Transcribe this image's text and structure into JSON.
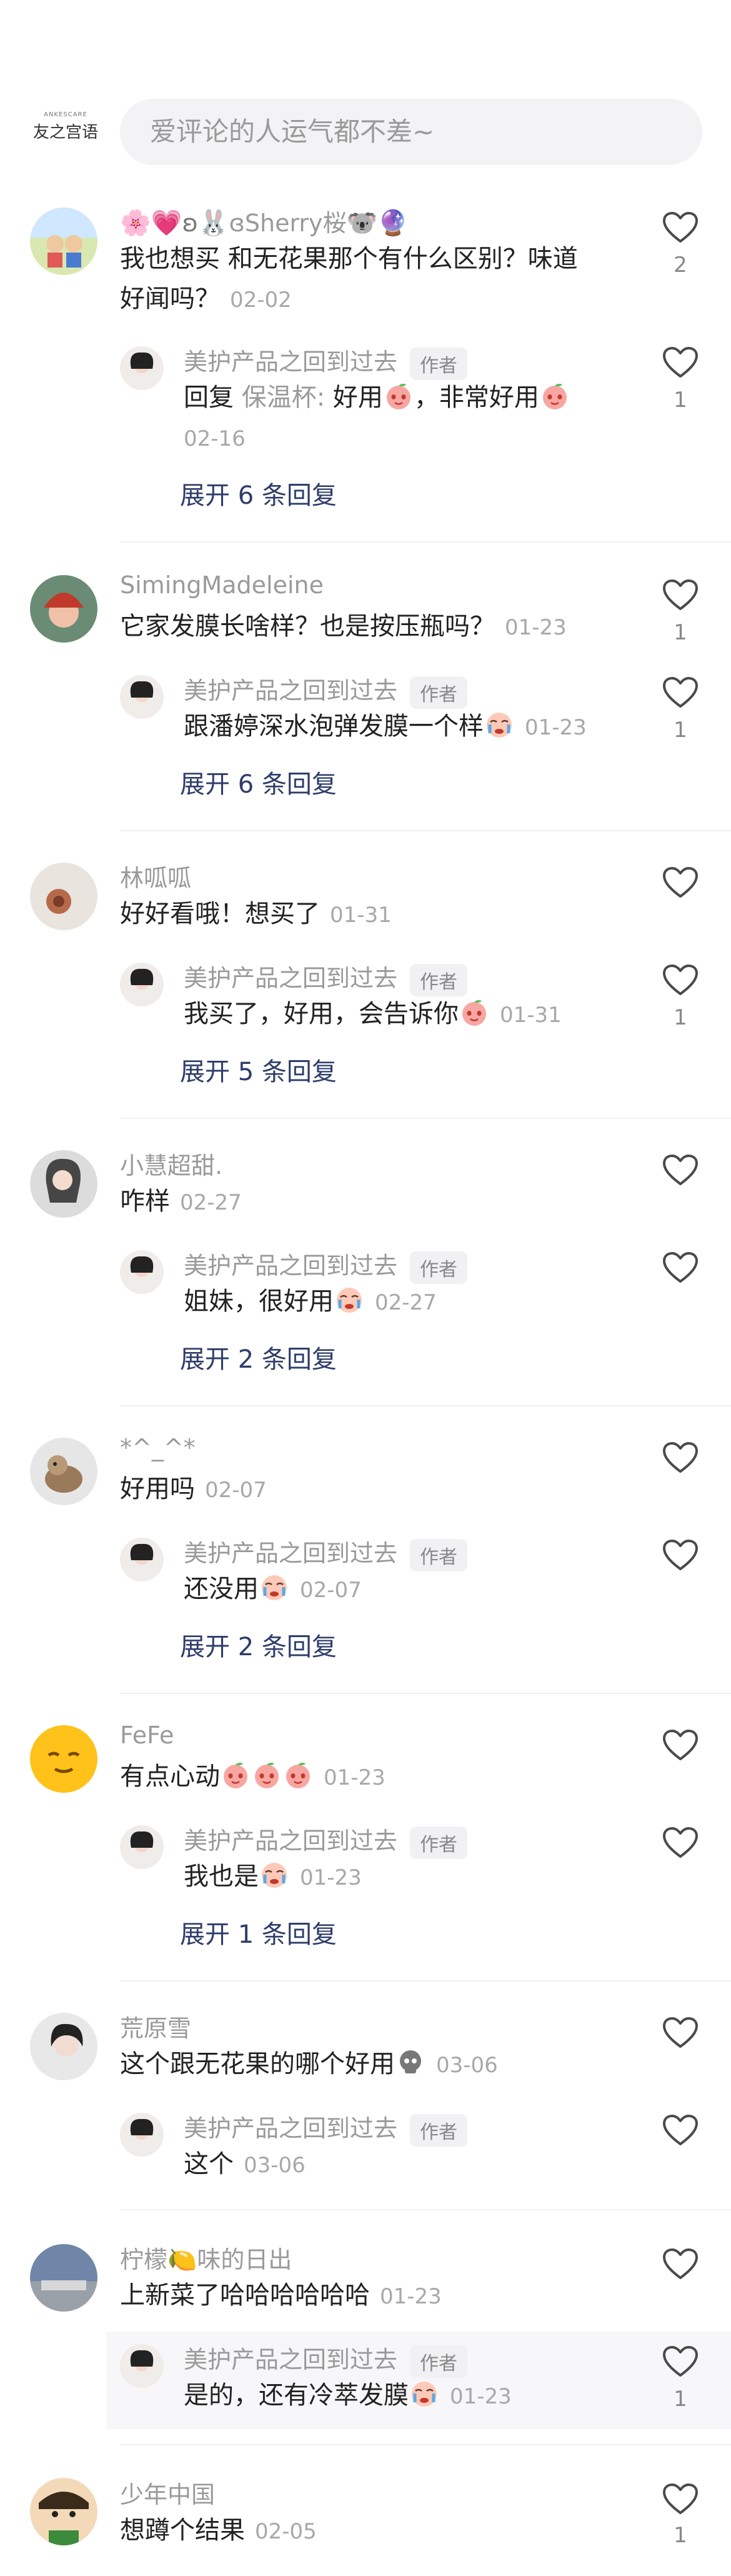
{
  "header": {
    "brand_small": "ANKESCARE",
    "brand_big": "友之宫语",
    "search_placeholder": "爱评论的人运气都不差~"
  },
  "labels": {
    "author": "作者",
    "reply_prefix": "回复"
  },
  "comments": [
    {
      "name": "ɞSherry桜",
      "text_line1": "我也想买  和无花果那个有什么区别？味道",
      "text_line2": "好闻吗？",
      "time": "02-02",
      "likes": "2",
      "reply": {
        "name": "美护产品之回到过去",
        "mention": "保温杯:",
        "text": "好用",
        "text2": "，非常好用",
        "time": "02-16",
        "likes": "1"
      },
      "expand": "展开 6 条回复"
    },
    {
      "name": "SimingMadeleine",
      "text": "它家发膜长啥样？也是按压瓶吗？",
      "time": "01-23",
      "likes": "1",
      "reply": {
        "name": "美护产品之回到过去",
        "text": "跟潘婷深水泡弹发膜一个样",
        "time": "01-23",
        "likes": "1"
      },
      "expand": "展开 6 条回复"
    },
    {
      "name": "林呱呱",
      "text": "好好看哦！想买了",
      "time": "01-31",
      "likes": "",
      "reply": {
        "name": "美护产品之回到过去",
        "text": "我买了，好用，会告诉你",
        "time": "01-31",
        "likes": "1"
      },
      "expand": "展开 5 条回复"
    },
    {
      "name": "小慧超甜.",
      "text": "咋样",
      "time": "02-27",
      "likes": "",
      "reply": {
        "name": "美护产品之回到过去",
        "text": "姐妹，很好用",
        "time": "02-27",
        "likes": ""
      },
      "expand": "展开 2 条回复"
    },
    {
      "name": "*^_^*",
      "text": "好用吗",
      "time": "02-07",
      "likes": "",
      "reply": {
        "name": "美护产品之回到过去",
        "text": "还没用",
        "time": "02-07",
        "likes": ""
      },
      "expand": "展开 2 条回复"
    },
    {
      "name": "FeFe",
      "text": "有点心动",
      "time": "01-23",
      "likes": "",
      "reply": {
        "name": "美护产品之回到过去",
        "text": "我也是",
        "time": "01-23",
        "likes": ""
      },
      "expand": "展开 1 条回复"
    },
    {
      "name": "荒原雪",
      "text": "这个跟无花果的哪个好用",
      "time": "03-06",
      "likes": "",
      "reply": {
        "name": "美护产品之回到过去",
        "text": "这个",
        "time": "03-06",
        "likes": ""
      }
    },
    {
      "name_a": "柠檬",
      "name_b": "味的日出",
      "text": "上新菜了哈哈哈哈哈哈",
      "time": "01-23",
      "likes": "",
      "reply": {
        "name": "美护产品之回到过去",
        "text": "是的，还有冷萃发膜",
        "time": "01-23",
        "likes": "1"
      }
    },
    {
      "name": "少年中国",
      "text": "想蹲个结果",
      "time": "02-05",
      "likes": "1"
    }
  ],
  "icons": {
    "like": "heart-outline-icon",
    "emoji_peach": "peach-emoji",
    "emoji_cry": "crying-emoji",
    "emoji_skull": "skull-emoji"
  },
  "colors": {
    "expand_link": "#2e3d6a",
    "meta_gray": "#9a9a9a",
    "search_bg": "#f3f3f5"
  }
}
